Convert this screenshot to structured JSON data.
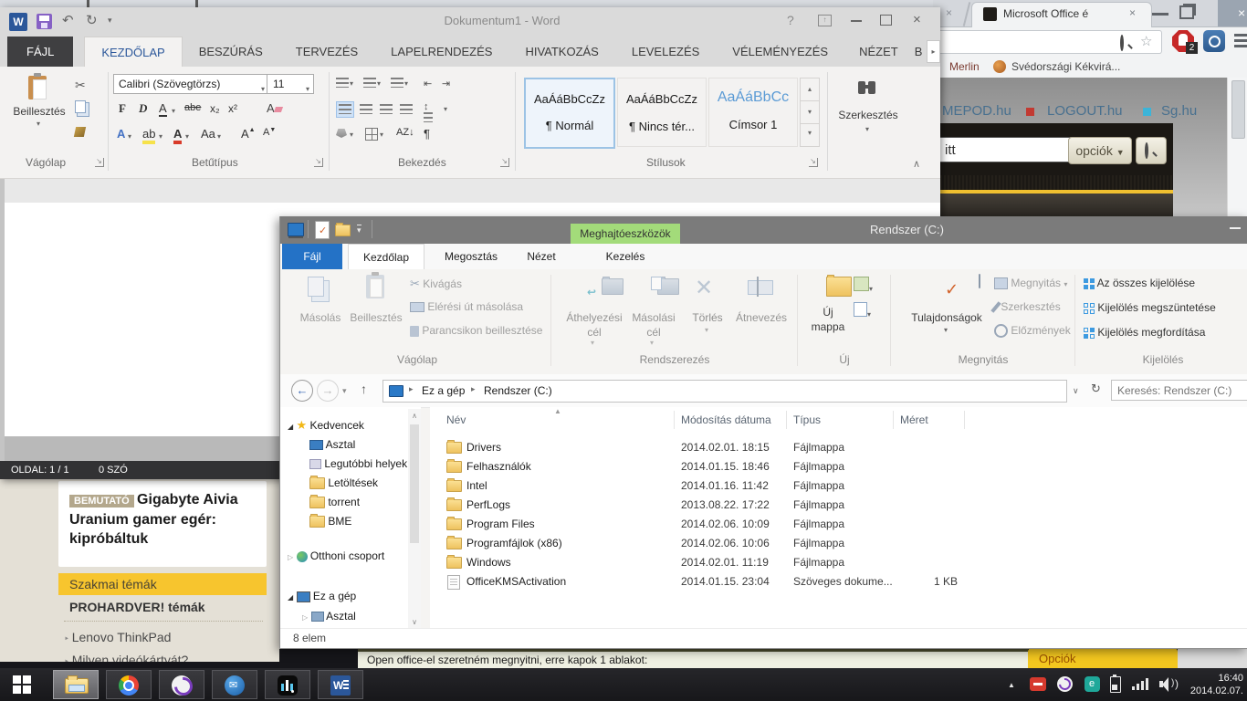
{
  "word": {
    "title": "Dokumentum1 - Word",
    "tabs": [
      "FÁJL",
      "KEZDŐLAP",
      "BESZÚRÁS",
      "TERVEZÉS",
      "LAPELRENDEZÉS",
      "HIVATKOZÁS",
      "LEVELEZÉS",
      "VÉLEMÉNYEZÉS",
      "NÉZET"
    ],
    "tab_overflow": "B",
    "ribbon": {
      "paste_label": "Beillesztés",
      "clipboard_group": "Vágólap",
      "font_name": "Calibri (Szövegtörzs)",
      "font_size": "11",
      "font_group": "Betűtípus",
      "bold": "F",
      "italic": "D",
      "underline": "A",
      "strike": "abe",
      "subscript": "x₂",
      "superscript": "x²",
      "aa": "Aa",
      "grow": "A",
      "shrink": "A",
      "effects": "A",
      "fontcolor": "A",
      "highlight": "ab",
      "sort": "AZ",
      "pilcrow": "¶",
      "paragraph_group": "Bekezdés",
      "styles": [
        {
          "sample": "AaÁáBbCcZz",
          "name": "¶ Normál"
        },
        {
          "sample": "AaÁáBbCcZz",
          "name": "¶ Nincs tér..."
        },
        {
          "sample": "AaÁáBbCc",
          "name": "Címsor 1"
        }
      ],
      "styles_group": "Stílusok",
      "editing_label": "Szerkesztés"
    },
    "status": {
      "page": "OLDAL: 1 / 1",
      "words": "0 SZÓ"
    }
  },
  "explorer": {
    "title": "Rendszer (C:)",
    "contextual_tab": "Meghajtóeszközök",
    "tabs": [
      "Fájl",
      "Kezdőlap",
      "Megosztás",
      "Nézet",
      "Kezelés"
    ],
    "ribbon": {
      "copy": "Másolás",
      "paste": "Beillesztés",
      "cut": "Kivágás",
      "copy_path": "Elérési út másolása",
      "paste_shortcut": "Parancsikon beillesztése",
      "clipboard_group": "Vágólap",
      "move_to": "Áthelyezési cél",
      "copy_to": "Másolási cél",
      "delete": "Törlés",
      "rename": "Átnevezés",
      "organize_group": "Rendszerezés",
      "new_folder_1": "Új",
      "new_folder_2": "mappa",
      "new_group": "Új",
      "properties": "Tulajdonságok",
      "open": "Megnyitás",
      "edit": "Szerkesztés",
      "history": "Előzmények",
      "open_group": "Megnyitás",
      "select_all": "Az összes kijelölése",
      "select_none": "Kijelölés megszüntetése",
      "select_invert": "Kijelölés megfordítása",
      "select_group": "Kijelölés"
    },
    "breadcrumb": {
      "root": "Ez a gép",
      "current": "Rendszer (C:)"
    },
    "search_placeholder": "Keresés: Rendszer (C:)",
    "nav": {
      "favorites": "Kedvencek",
      "desktop": "Asztal",
      "recent": "Legutóbbi helyek",
      "downloads": "Letöltések",
      "torrent": "torrent",
      "bme": "BME",
      "homegroup": "Otthoni csoport",
      "thispc": "Ez a gép",
      "desktop2": "Asztal"
    },
    "columns": {
      "name": "Név",
      "date": "Módosítás dátuma",
      "type": "Típus",
      "size": "Méret"
    },
    "files": [
      {
        "name": "Drivers",
        "date": "2014.02.01. 18:15",
        "type": "Fájlmappa",
        "size": ""
      },
      {
        "name": "Felhasználók",
        "date": "2014.01.15. 18:46",
        "type": "Fájlmappa",
        "size": ""
      },
      {
        "name": "Intel",
        "date": "2014.01.16. 11:42",
        "type": "Fájlmappa",
        "size": ""
      },
      {
        "name": "PerfLogs",
        "date": "2013.08.22. 17:22",
        "type": "Fájlmappa",
        "size": ""
      },
      {
        "name": "Program Files",
        "date": "2014.02.06. 10:09",
        "type": "Fájlmappa",
        "size": ""
      },
      {
        "name": "Programfájlok (x86)",
        "date": "2014.02.06. 10:06",
        "type": "Fájlmappa",
        "size": ""
      },
      {
        "name": "Windows",
        "date": "2014.02.01. 11:19",
        "type": "Fájlmappa",
        "size": ""
      },
      {
        "name": "OfficeKMSActivation",
        "date": "2014.01.15. 23:04",
        "type": "Szöveges dokume...",
        "size": "1 KB"
      }
    ],
    "status": "8 elem"
  },
  "browser": {
    "tab_title": "Microsoft Office é",
    "adblock_badge": "2",
    "bookmarks": {
      "first": "Merlin",
      "second": "Svédországi Kékvirá..."
    },
    "page": {
      "links": [
        "MEPOD.hu",
        "LOGOUT.hu",
        "Sg.hu"
      ],
      "search_value": "itt",
      "options_button": "opciók",
      "article_badge": "BEMUTATÓ",
      "article_title": "Gigabyte Aivia Uranium gamer egér: kipróbáltuk",
      "sidebar_highlight": "Szakmai témák",
      "sidebar_heading": "PROHARDVER! témák",
      "sidebar_link1": "Lenovo ThinkPad",
      "sidebar_link2": "Milyen videókártyát?",
      "bottom_text": "Open office-el szeretném megnyitni, erre kapok 1 ablakot:",
      "bottom_button": "Opciók"
    }
  },
  "taskbar": {
    "clock_time": "16:40",
    "clock_date": "2014.02.07."
  }
}
